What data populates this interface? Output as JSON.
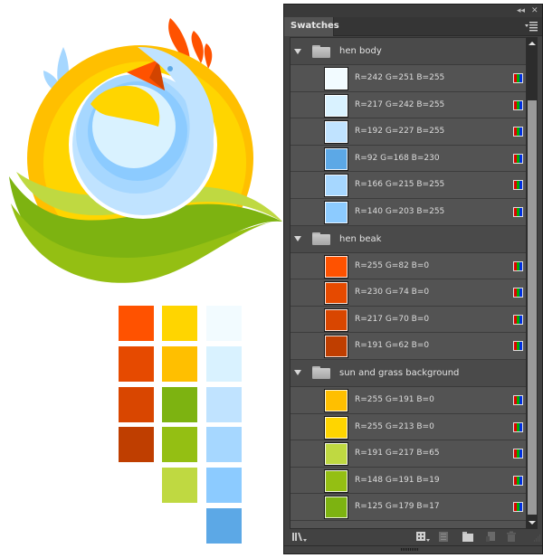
{
  "panel": {
    "tab_label": "Swatches",
    "titlebar_icons": {
      "collapse": "double-chevron-left-icon",
      "close": "close-icon"
    },
    "menu_icon": "panel-menu-icon",
    "groups": [
      {
        "name": "hen body",
        "swatches": [
          {
            "label": "R=242 G=251 B=255",
            "color": "#F2FBFF"
          },
          {
            "label": "R=217 G=242 B=255",
            "color": "#D9F2FF"
          },
          {
            "label": "R=192 G=227 B=255",
            "color": "#C0E3FF"
          },
          {
            "label": "R=92 G=168 B=230",
            "color": "#5CA8E6"
          },
          {
            "label": "R=166 G=215 B=255",
            "color": "#A6D7FF"
          },
          {
            "label": "R=140 G=203 B=255",
            "color": "#8CCBFF"
          }
        ]
      },
      {
        "name": "hen beak",
        "swatches": [
          {
            "label": "R=255 G=82 B=0",
            "color": "#FF5200"
          },
          {
            "label": "R=230 G=74 B=0",
            "color": "#E64A00"
          },
          {
            "label": "R=217 G=70 B=0",
            "color": "#D94600"
          },
          {
            "label": "R=191 G=62 B=0",
            "color": "#BF3E00"
          }
        ]
      },
      {
        "name": "sun and grass background",
        "swatches": [
          {
            "label": "R=255 G=191 B=0",
            "color": "#FFBF00"
          },
          {
            "label": "R=255 G=213 B=0",
            "color": "#FFD500"
          },
          {
            "label": "R=191 G=217 B=65",
            "color": "#BFD941"
          },
          {
            "label": "R=148 G=191 B=19",
            "color": "#94BF13"
          },
          {
            "label": "R=125 G=179 B=17",
            "color": "#7DB311"
          }
        ]
      }
    ],
    "bottom_icons": [
      "swatch-libraries-icon",
      "show-kinds-icon",
      "swatch-options-icon",
      "new-color-group-icon",
      "new-swatch-icon",
      "delete-swatch-icon"
    ]
  },
  "palette_chips": {
    "columns": [
      [
        "#FF5200",
        "#E64A00",
        "#D94600",
        "#BF3E00"
      ],
      [
        "#FFD500",
        "#FFBF00",
        "#7DB311",
        "#94BF13",
        "#BFD941"
      ],
      [
        "#F2FBFF",
        "#D9F2FF",
        "#C0E3FF",
        "#A6D7FF",
        "#8CCBFF",
        "#5CA8E6"
      ]
    ]
  },
  "illustration": {
    "subject": "hen over sun and grass",
    "colors": {
      "sun_outer": "#FFBF00",
      "sun_inner": "#FFD500",
      "grass_light": "#BFD941",
      "grass_mid": "#94BF13",
      "grass_dark": "#7DB311",
      "comb": "#FF5200",
      "beak": "#FF5200",
      "beak_shade": "#BF3E00",
      "body_1": "#C0E3FF",
      "body_2": "#A6D7FF",
      "body_3": "#8CCBFF",
      "body_4": "#D9F2FF",
      "eye": "#5CA8E6",
      "tail": "#A6D7FF"
    }
  }
}
